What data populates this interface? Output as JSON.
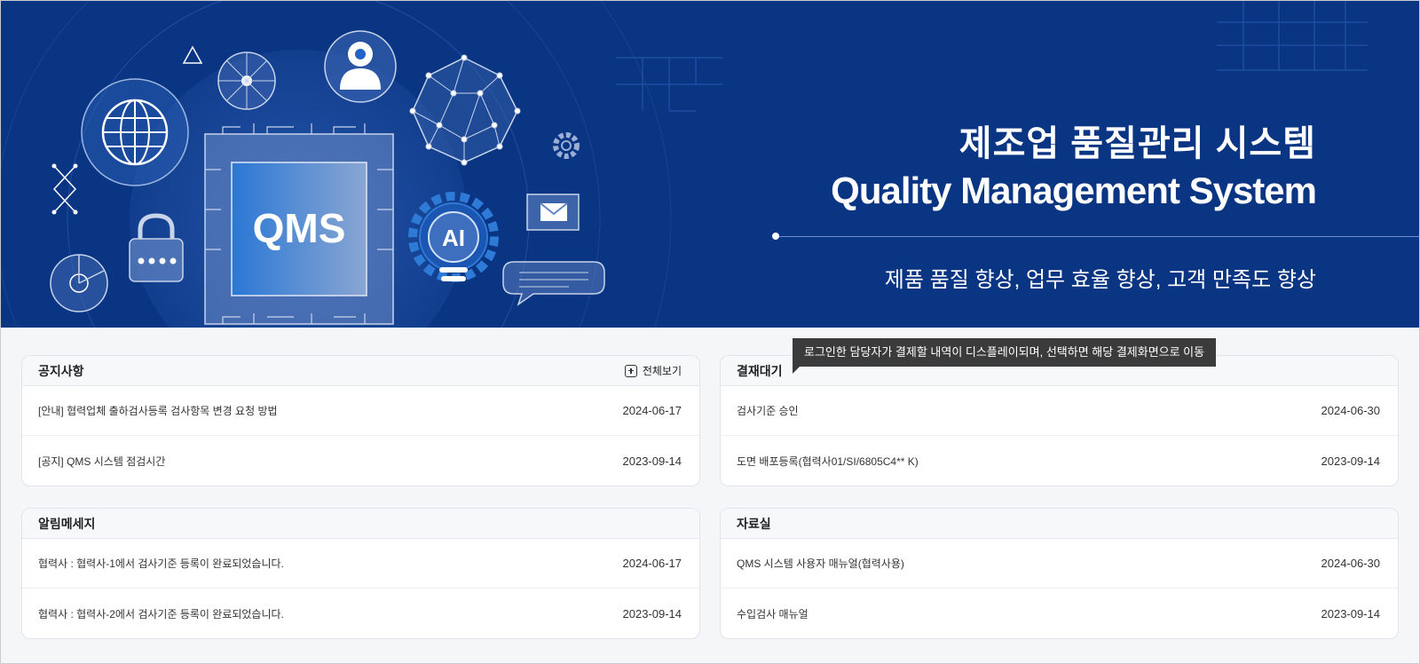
{
  "banner": {
    "title": "제조업 품질관리 시스템",
    "subtitle": "Quality Management System",
    "tagline": "제품 품질 향상, 업무 효율 향상, 고객 만족도 향상",
    "chip_label": "QMS",
    "ai_label": "AI",
    "colors": {
      "background": "#0a3583",
      "accent": "#2d7bd6"
    }
  },
  "notice": {
    "title": "공지사항",
    "view_all": "전체보기",
    "rows": [
      {
        "text": "[안내] 협력업체  출하검사등록 검사항목 변경 요청 방법",
        "date": "2024-06-17"
      },
      {
        "text": "[공지] QMS 시스템 점검시간",
        "date": "2023-09-14"
      }
    ]
  },
  "approval": {
    "title": "결재대기",
    "tooltip": "로그인한 담당자가 결제할 내역이 디스플레이되며, 선택하면 해당 결제화면으로 이동",
    "rows": [
      {
        "text": "검사기준 승인",
        "date": "2024-06-30"
      },
      {
        "text": "도면 배포등록(협력사01/SI/6805C4** K)",
        "date": "2023-09-14"
      }
    ]
  },
  "alerts": {
    "title": "알림메세지",
    "rows": [
      {
        "text": "협력사 : 협력사-1에서 검사기준 등록이 완료되었습니다.",
        "date": "2024-06-17"
      },
      {
        "text": "협력사 : 협력사-2에서 검사기준 등록이 완료되었습니다.",
        "date": "2023-09-14"
      }
    ]
  },
  "library": {
    "title": "자료실",
    "rows": [
      {
        "text": "QMS 시스템 사용자 매뉴얼(협력사용)",
        "date": "2024-06-30"
      },
      {
        "text": "수입검사 매뉴얼",
        "date": "2023-09-14"
      }
    ]
  }
}
